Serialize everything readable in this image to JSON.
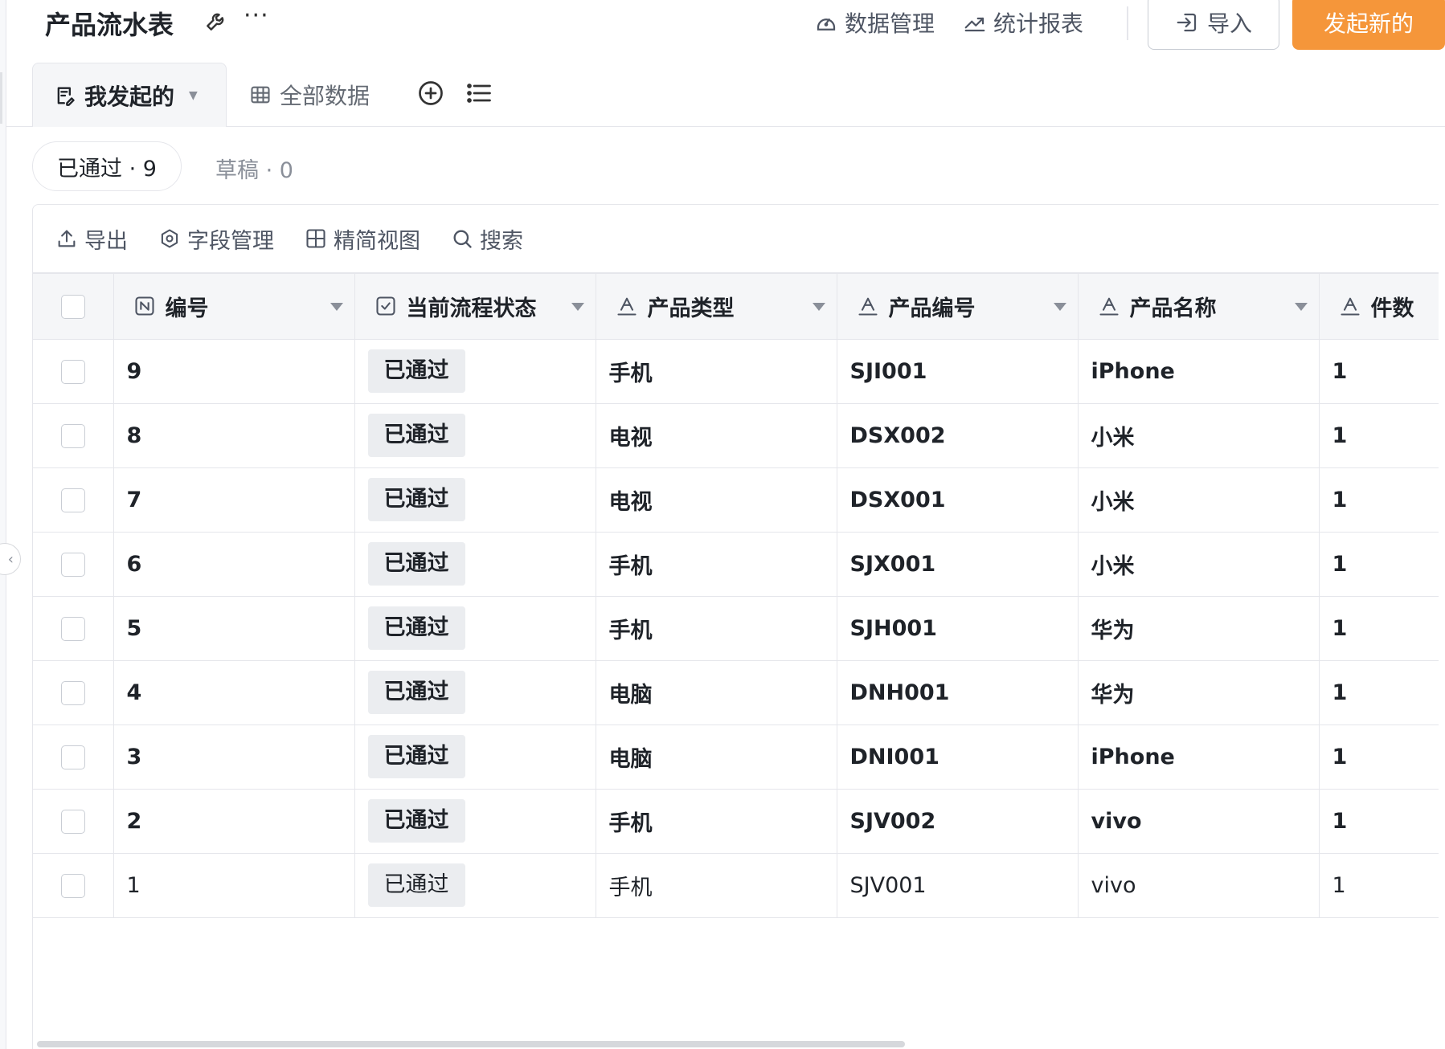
{
  "header": {
    "title": "产品流水表",
    "more": "···",
    "data_manage": "数据管理",
    "stats_report": "统计报表",
    "import_label": "导入",
    "new_label": "发起新的",
    "new_color": "#f5963a"
  },
  "tabs": {
    "mine": "我发起的",
    "all": "全部数据"
  },
  "filters": {
    "approved": "已通过 · 9",
    "draft": "草稿 · 0"
  },
  "toolbar": {
    "export": "导出",
    "fields": "字段管理",
    "compact": "精简视图",
    "search": "搜索"
  },
  "table": {
    "columns": [
      "编号",
      "当前流程状态",
      "产品类型",
      "产品编号",
      "产品名称",
      "件数"
    ],
    "rows": [
      {
        "id": "9",
        "status": "已通过",
        "type": "手机",
        "code": "SJI001",
        "name": "iPhone",
        "qty": "1"
      },
      {
        "id": "8",
        "status": "已通过",
        "type": "电视",
        "code": "DSX002",
        "name": "小米",
        "qty": "1"
      },
      {
        "id": "7",
        "status": "已通过",
        "type": "电视",
        "code": "DSX001",
        "name": "小米",
        "qty": "1"
      },
      {
        "id": "6",
        "status": "已通过",
        "type": "手机",
        "code": "SJX001",
        "name": "小米",
        "qty": "1"
      },
      {
        "id": "5",
        "status": "已通过",
        "type": "手机",
        "code": "SJH001",
        "name": "华为",
        "qty": "1"
      },
      {
        "id": "4",
        "status": "已通过",
        "type": "电脑",
        "code": "DNH001",
        "name": "华为",
        "qty": "1"
      },
      {
        "id": "3",
        "status": "已通过",
        "type": "电脑",
        "code": "DNI001",
        "name": "iPhone",
        "qty": "1"
      },
      {
        "id": "2",
        "status": "已通过",
        "type": "手机",
        "code": "SJV002",
        "name": "vivo",
        "qty": "1"
      },
      {
        "id": "1",
        "status": "已通过",
        "type": "手机",
        "code": "SJV001",
        "name": "vivo",
        "qty": "1"
      }
    ]
  }
}
